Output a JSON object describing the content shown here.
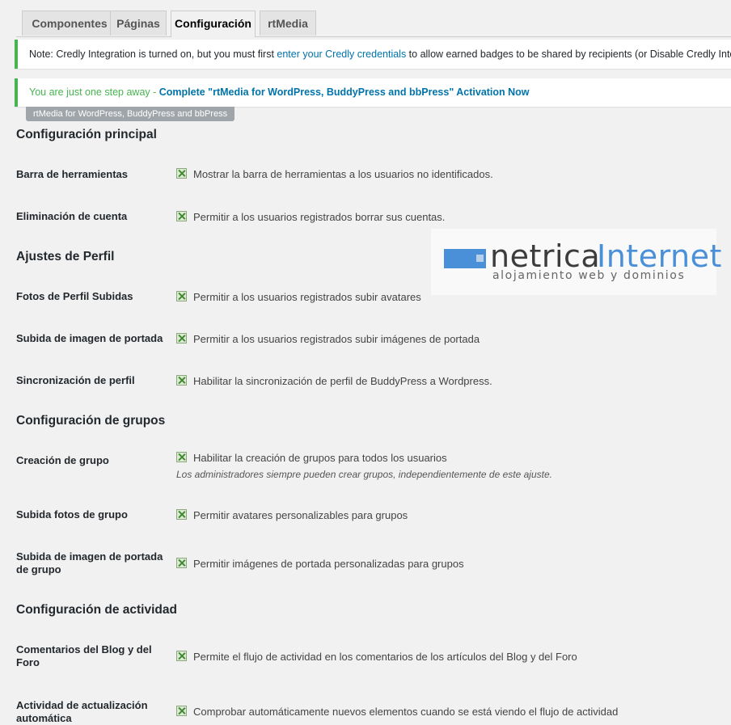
{
  "tabs": [
    "Componentes",
    "Páginas",
    "Configuración",
    "rtMedia"
  ],
  "notice_credly": {
    "before": "Note: Credly Integration is turned on, but you must first ",
    "link": "enter your Credly credentials",
    "after": " to allow earned badges to be shared by recipients (or Disable Credly Integ"
  },
  "notice_rtmedia": {
    "lead": "You are just one step away - ",
    "link": "Complete \"rtMedia for WordPress, BuddyPress and bbPress\" Activation Now"
  },
  "plugin_badge": "rtMedia for WordPress, BuddyPress and bbPress",
  "logo": {
    "word1": "netrica",
    "word2": "Internet",
    "sub": "alojamiento web y dominios"
  },
  "sections": {
    "main": "Configuración principal",
    "profile": "Ajustes de Perfil",
    "groups": "Configuración de grupos",
    "activity": "Configuración de actividad"
  },
  "rows": {
    "toolbar": {
      "label": "Barra de herramientas",
      "text": "Mostrar la barra de herramientas a los usuarios no identificados."
    },
    "account_delete": {
      "label": "Eliminación de cuenta",
      "text": "Permitir a los usuarios registrados borrar sus cuentas."
    },
    "avatar_upload": {
      "label": "Fotos de Perfil Subidas",
      "text": "Permitir a los usuarios registrados subir avatares"
    },
    "cover_upload": {
      "label": "Subida de imagen de portada",
      "text": "Permitir a los usuarios registrados subir imágenes de portada"
    },
    "profile_sync": {
      "label": "Sincronización de perfil",
      "text": "Habilitar la sincronización de perfil de BuddyPress a Wordpress."
    },
    "group_create": {
      "label": "Creación de grupo",
      "text": "Habilitar la creación de grupos para todos los usuarios",
      "desc": "Los administradores siempre pueden crear grupos, independientemente de este ajuste."
    },
    "group_avatar": {
      "label": "Subida fotos de grupo",
      "text": "Permitir avatares personalizables para grupos"
    },
    "group_cover": {
      "label": "Subida de imagen de portada de grupo",
      "text": "Permitir imágenes de portada personalizadas para grupos"
    },
    "blog_comments": {
      "label": "Comentarios del Blog y del Foro",
      "text": "Permite el flujo de actividad en los comentarios de los artículos del Blog y del Foro"
    },
    "heartbeat": {
      "label": "Actividad de actualización automática",
      "text": "Comprobar automáticamente nuevos elementos cuando se está viendo el flujo de actividad"
    }
  },
  "checkbox_state": "checked"
}
